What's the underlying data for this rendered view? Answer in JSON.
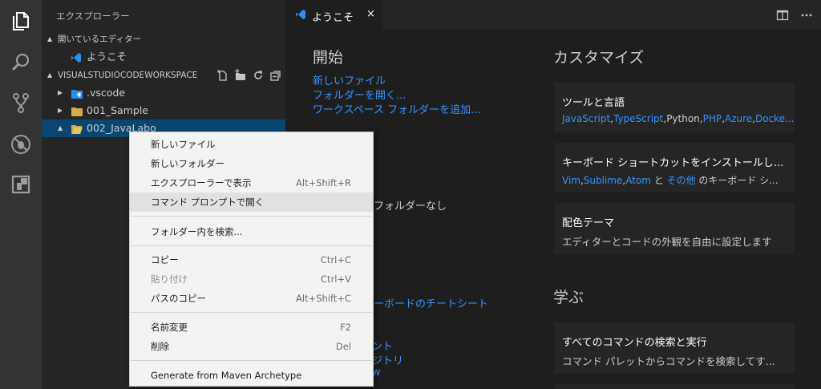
{
  "sidebar": {
    "title": "エクスプローラー",
    "open_editors_label": "開いているエディター",
    "open_editors": [
      {
        "label": "ようこそ",
        "icon": "vscode-icon"
      }
    ],
    "workspace_label": "VISUALSTUDIOCODEWORKSPACE",
    "tree": [
      {
        "label": ".vscode",
        "icon": "vscode-folder-icon"
      },
      {
        "label": "001_Sample",
        "icon": "folder-icon"
      },
      {
        "label": "002_JavaLabo",
        "icon": "folder-open-icon"
      }
    ]
  },
  "tab": {
    "label": "ようこそ",
    "close": "×"
  },
  "welcome": {
    "start_heading": "開始",
    "start_links": [
      "新しいファイル",
      "フォルダーを開く...",
      "ワークスペース フォルダーを追加..."
    ],
    "recent_fragment": "フォルダーなし",
    "help_fragment": "ーボードのチートシート",
    "help_fragment2": "ント",
    "help_fragment3": "ジトリ",
    "help_fragment4": "w",
    "customize_heading": "カスタマイズ",
    "cards_custom": [
      {
        "title": "ツールと言語",
        "desc_links": [
          "JavaScript",
          "TypeScript",
          "Python",
          "PHP",
          "Azure",
          "Docke..."
        ],
        "desc_seps": [
          ",",
          ",",
          ",",
          ",",
          ","
        ]
      },
      {
        "title": "キーボード ショートカットをインストールし...",
        "desc_a1": "Vim",
        "desc_a2": "Sublime",
        "desc_a3": "Atom",
        "desc_and": " と ",
        "desc_a4": "その他",
        "desc_tail": " のキーボード シ..."
      },
      {
        "title": "配色テーマ",
        "desc": "エディターとコードの外観を自由に設定します"
      }
    ],
    "learn_heading": "学ぶ",
    "cards_learn": [
      {
        "title": "すべてのコマンドの検索と実行",
        "desc": "コマンド パレットからコマンドを検索してす..."
      }
    ]
  },
  "menu": {
    "groups": [
      [
        {
          "label": "新しいファイル",
          "key": ""
        },
        {
          "label": "新しいフォルダー",
          "key": ""
        },
        {
          "label": "エクスプローラーで表示",
          "key": "Alt+Shift+R"
        },
        {
          "label": "コマンド プロンプトで開く",
          "key": ""
        }
      ],
      [
        {
          "label": "フォルダー内を検索...",
          "key": ""
        }
      ],
      [
        {
          "label": "コピー",
          "key": "Ctrl+C"
        },
        {
          "label": "貼り付け",
          "key": "Ctrl+V"
        },
        {
          "label": "パスのコピー",
          "key": "Alt+Shift+C"
        }
      ],
      [
        {
          "label": "名前変更",
          "key": "F2"
        },
        {
          "label": "削除",
          "key": "Del"
        }
      ],
      [
        {
          "label": "Generate from Maven Archetype",
          "key": ""
        }
      ]
    ]
  },
  "colors": {
    "accent": "#3794ff",
    "selection": "#094771",
    "activity_bar": "#333333",
    "sidebar": "#252526",
    "editor": "#1e1e1e",
    "vscode_blue": "#2c8ff0",
    "folder": "#d8a84b"
  }
}
